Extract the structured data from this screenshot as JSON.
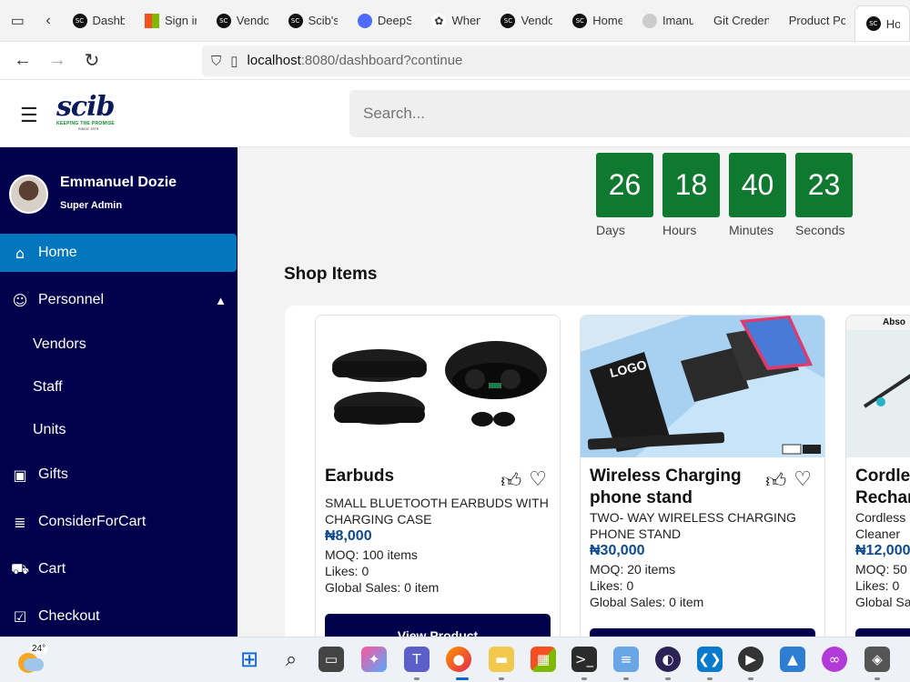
{
  "browser": {
    "tabs": [
      {
        "label": "Dashb",
        "favicon": "sc-logo-icon"
      },
      {
        "label": "Sign ir",
        "favicon": "microsoft-icon"
      },
      {
        "label": "Vendo",
        "favicon": "sc-logo-icon"
      },
      {
        "label": "Scib's",
        "favicon": "sc-logo-icon"
      },
      {
        "label": "DeepS",
        "favicon": "deepseek-icon"
      },
      {
        "label": "When",
        "favicon": "paw-icon"
      },
      {
        "label": "Vendo",
        "favicon": "sc-logo-icon"
      },
      {
        "label": "Home",
        "favicon": "sc-logo-icon"
      },
      {
        "label": "Imanu",
        "favicon": "github-icon"
      },
      {
        "label": "Git Creden",
        "favicon": "none"
      },
      {
        "label": "Product Po",
        "favicon": "none"
      },
      {
        "label": "Ho",
        "favicon": "sc-logo-icon",
        "active": true
      }
    ],
    "url_host": "localhost",
    "url_rest": ":8080/dashboard?continue"
  },
  "header": {
    "logo_text": "scib",
    "logo_tagline": "KEEPING THE PROMISE",
    "logo_since": "SINCE 1979",
    "search_placeholder": "Search..."
  },
  "sidebar": {
    "user_name": "Emmanuel Dozie",
    "user_role": "Super Admin",
    "items": [
      {
        "label": "Home",
        "icon": "home-icon",
        "active": true
      },
      {
        "label": "Personnel",
        "icon": "people-icon",
        "expanded": true
      },
      {
        "label": "Gifts",
        "icon": "gift-icon"
      },
      {
        "label": "ConsiderForCart",
        "icon": "list-icon"
      },
      {
        "label": "Cart",
        "icon": "cart-icon"
      },
      {
        "label": "Checkout",
        "icon": "checkout-icon"
      }
    ],
    "sub_items": [
      "Vendors",
      "Staff",
      "Units"
    ]
  },
  "countdown": {
    "days": "26",
    "hours": "18",
    "minutes": "40",
    "seconds": "23",
    "days_label": "Days",
    "hours_label": "Hours",
    "minutes_label": "Minutes",
    "seconds_label": "Seconds"
  },
  "shop": {
    "title": "Shop Items",
    "button_label": "View Product",
    "items": [
      {
        "title": "Earbuds",
        "desc": "SMALL BLUETOOTH EARBUDS WITH CHARGING CASE",
        "price": "₦8,000",
        "moq": "MOQ: 100 items",
        "likes": "Likes: 0",
        "sales": "Global Sales: 0 item"
      },
      {
        "title": "Wireless Charging phone stand",
        "desc": "TWO- WAY WIRELESS CHARGING PHONE STAND",
        "price": "₦30,000",
        "moq": "MOQ: 20 items",
        "likes": "Likes: 0",
        "sales": "Global Sales: 0 item",
        "image_text": "LOGO"
      },
      {
        "title": "Cordless Rechar",
        "desc": "Cordless Cleaner",
        "price": "₦12,000",
        "moq": "MOQ: 50",
        "likes": "Likes: 0",
        "sales": "Global Sa",
        "image_text": "Abso"
      }
    ]
  },
  "taskbar": {
    "temperature": "24°"
  },
  "colors": {
    "sidebar_bg": "#00004d",
    "active_item": "#0277bd",
    "countdown_green": "#0f7a2f",
    "price_blue": "#0d4a8f"
  }
}
